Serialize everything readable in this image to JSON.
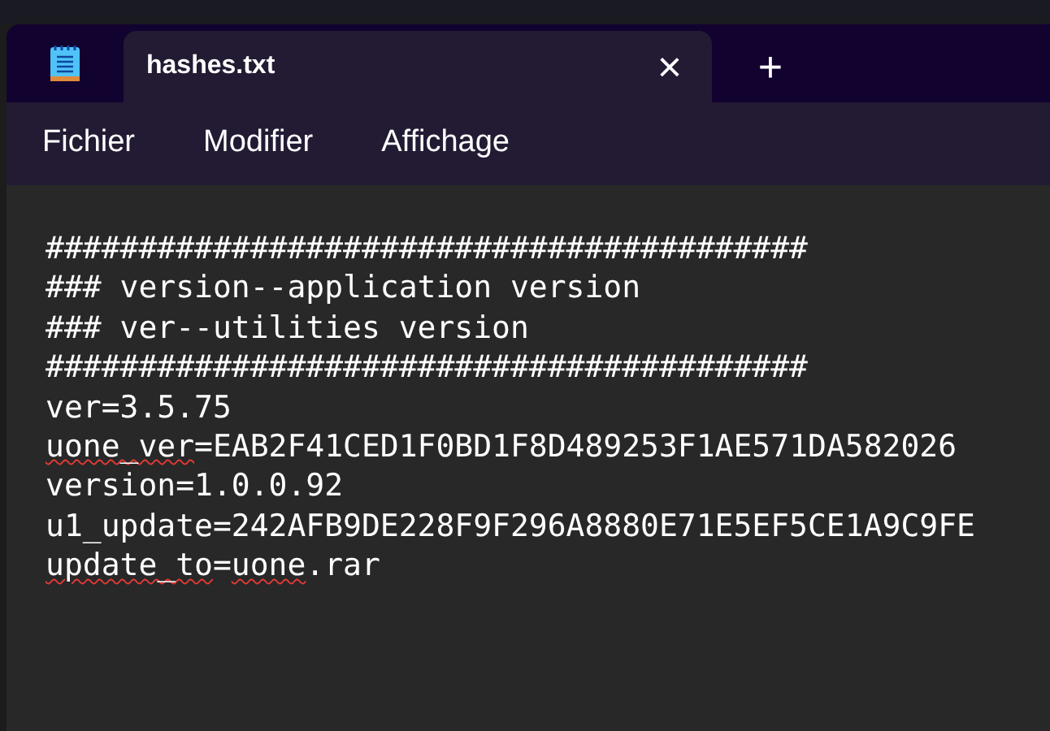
{
  "tab": {
    "title": "hashes.txt",
    "selected": true,
    "close": "×",
    "new": "+"
  },
  "menu": [
    "Fichier",
    "Modifier",
    "Affichage"
  ],
  "lines": [
    [
      {
        "text": "#########################################",
        "misspelled": false
      }
    ],
    [
      {
        "text": "### version--application version",
        "misspelled": false
      }
    ],
    [
      {
        "text": "### ver--utilities version",
        "misspelled": false
      }
    ],
    [
      {
        "text": "#########################################",
        "misspelled": false
      }
    ],
    [
      {
        "text": "ver=3.5.75",
        "misspelled": false
      }
    ],
    [
      {
        "text": "uone_ver",
        "misspelled": true
      },
      {
        "text": "=EAB2F41CED1F0BD1F8D489253F1AE571DA582026",
        "misspelled": false
      }
    ],
    [
      {
        "text": "version=1.0.0.92",
        "misspelled": false
      }
    ],
    [
      {
        "text": "u1_update=242AFB9DE228F9F296A8880E71E5EF5CE1A9C9FE",
        "misspelled": false
      }
    ],
    [
      {
        "text": "update_to",
        "misspelled": true
      },
      {
        "text": "=",
        "misspelled": false
      },
      {
        "text": "uone",
        "misspelled": true
      },
      {
        "text": ".rar",
        "misspelled": false
      }
    ]
  ]
}
